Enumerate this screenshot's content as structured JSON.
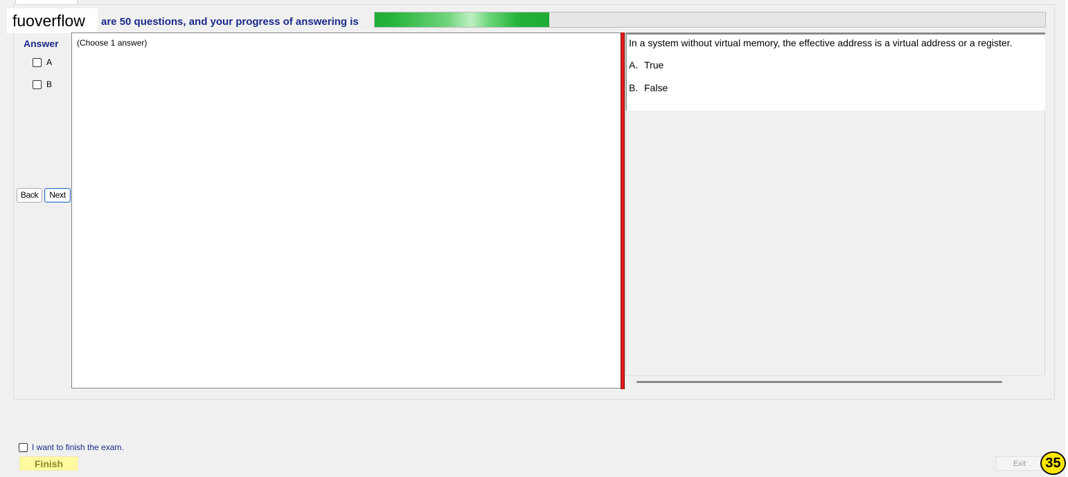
{
  "header": {
    "watermark": "fuoverflow",
    "progress_text": "are 50 questions, and your progress of answering is",
    "progress_fraction": 0.26
  },
  "answer_panel": {
    "title": "Answer",
    "options": [
      {
        "label": "A",
        "checked": false
      },
      {
        "label": "B",
        "checked": false
      }
    ],
    "back_label": "Back",
    "next_label": "Next",
    "instruction": "(Choose 1 answer)"
  },
  "question": {
    "text": "In a system without virtual memory, the effective address is a virtual address or a register.",
    "choices": [
      {
        "letter": "A.",
        "text": "True"
      },
      {
        "letter": "B.",
        "text": "False"
      }
    ]
  },
  "footer": {
    "finish_checkbox_label": "I want to finish the exam.",
    "finish_label": "Finish",
    "exit_label": "Exit",
    "badge": "35"
  },
  "colors": {
    "accent_text": "#1a2a8a",
    "progress": "#20ae36",
    "splitter": "#e21a1a",
    "badge": "#ffe800"
  }
}
